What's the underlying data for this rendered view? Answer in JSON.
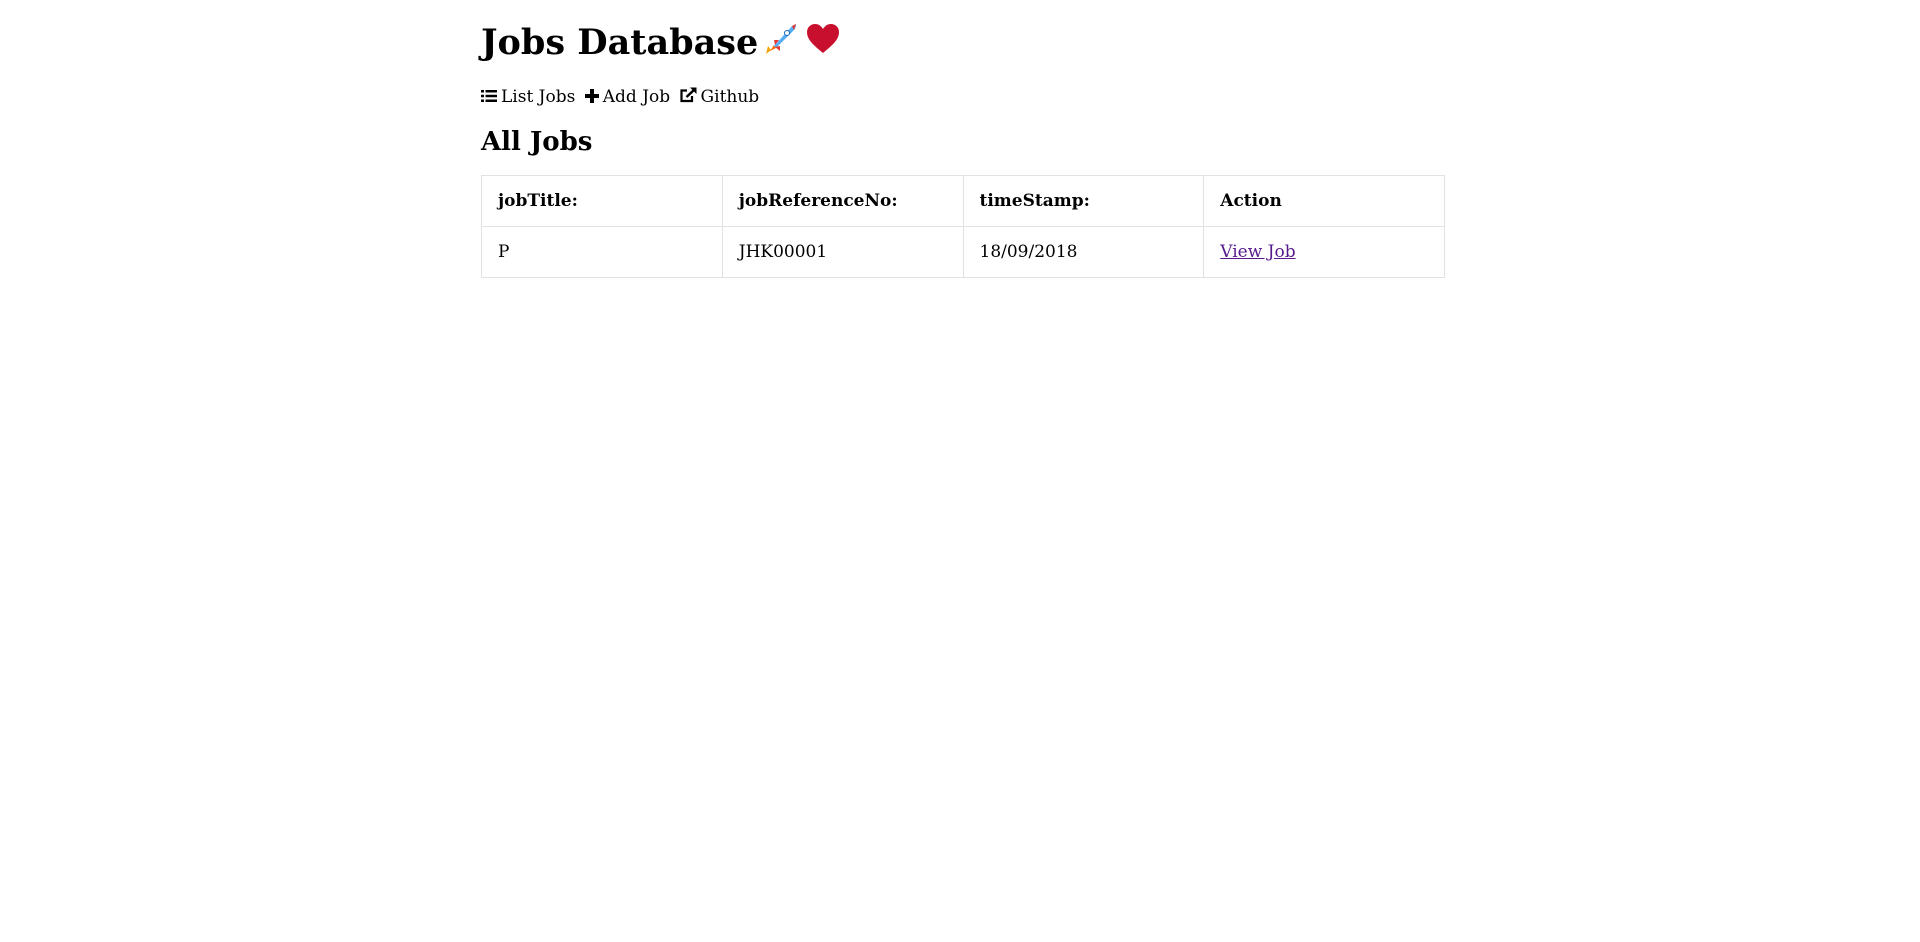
{
  "app": {
    "title": "Jobs Database",
    "emojis": [
      "🚀",
      "❤"
    ]
  },
  "nav": {
    "items": [
      {
        "label": "List Jobs",
        "icon": "list-icon"
      },
      {
        "label": "Add Job",
        "icon": "plus-icon"
      },
      {
        "label": "Github",
        "icon": "external-link-icon"
      }
    ]
  },
  "main": {
    "heading": "All Jobs",
    "table": {
      "headers": [
        "jobTitle:",
        "jobReferenceNo:",
        "timeStamp:",
        "Action"
      ],
      "rows": [
        {
          "jobTitle": "P",
          "jobReferenceNo": "JHK00001",
          "timeStamp": "18/09/2018",
          "action": "View Job"
        }
      ]
    }
  },
  "colors": {
    "link_visited": "#551a8b",
    "border": "#e2e2e2",
    "heart": "#c8102e"
  }
}
